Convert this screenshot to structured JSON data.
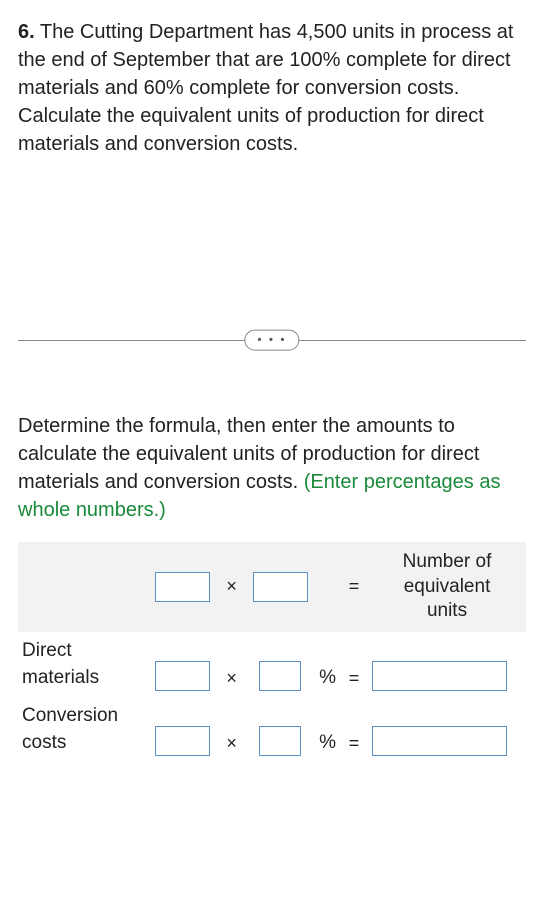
{
  "question": {
    "number": "6.",
    "text": "The Cutting Department has 4,500 units in process at the end of September that are 100% complete for direct materials and 60% complete for conversion costs. Calculate the equivalent units of production for direct materials and conversion costs."
  },
  "divider": {
    "label": "• • •"
  },
  "instruction": {
    "text": "Determine the formula, then enter the amounts to calculate the equivalent units of production for direct materials and conversion costs. ",
    "hint": "(Enter percentages as whole numbers.)"
  },
  "table": {
    "header": {
      "result_line1": "Number of",
      "result_line2": "equivalent",
      "result_line3": "units"
    },
    "ops": {
      "times": "×",
      "equals": "=",
      "percent": "%"
    },
    "rows": [
      {
        "label_line1": "Direct",
        "label_line2": "materials",
        "units": "",
        "pct": "",
        "result": ""
      },
      {
        "label_line1": "Conversion",
        "label_line2": "costs",
        "units": "",
        "pct": "",
        "result": ""
      }
    ]
  }
}
